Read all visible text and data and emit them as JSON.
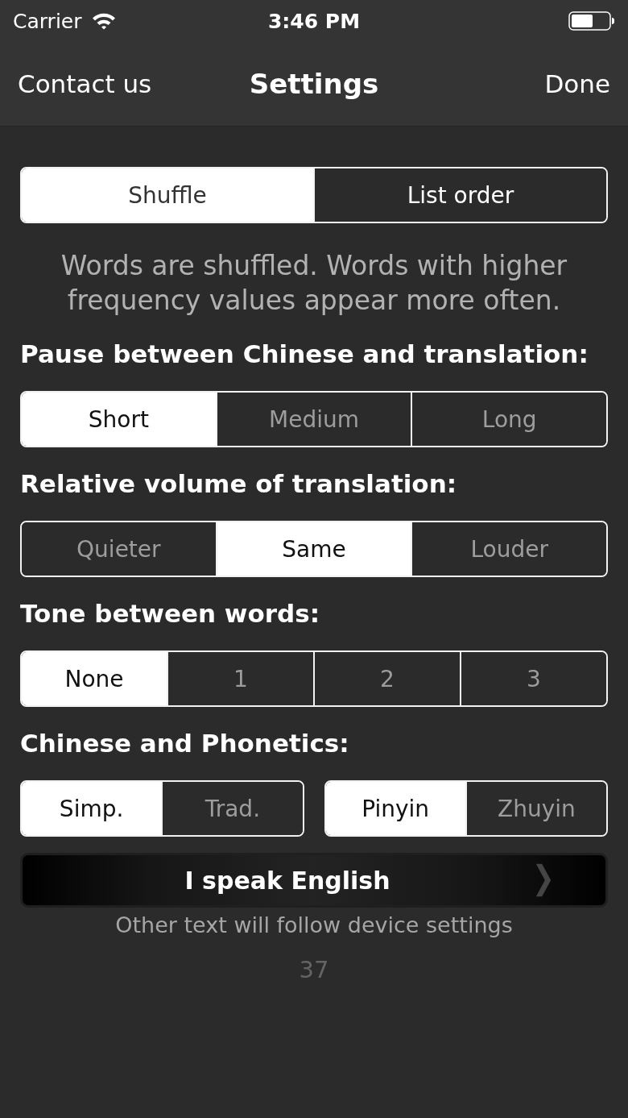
{
  "status_bar": {
    "carrier": "Carrier",
    "time": "3:46 PM"
  },
  "nav_bar": {
    "left_button": "Contact us",
    "title": "Settings",
    "right_button": "Done"
  },
  "order": {
    "kind": "bright",
    "segments": [
      {
        "label": "Shuffle",
        "selected": true
      },
      {
        "label": "List order",
        "selected": false
      }
    ]
  },
  "order_description": "Words are shuffled. Words with higher frequency values appear more often.",
  "settings": [
    {
      "heading": "Pause between Chinese and translation:",
      "controls": [
        {
          "kind": "dim",
          "segments": [
            {
              "label": "Short",
              "selected": true
            },
            {
              "label": "Medium",
              "selected": false
            },
            {
              "label": "Long",
              "selected": false
            }
          ]
        }
      ]
    },
    {
      "heading": "Relative volume of translation:",
      "controls": [
        {
          "kind": "dim",
          "segments": [
            {
              "label": "Quieter",
              "selected": false
            },
            {
              "label": "Same",
              "selected": true
            },
            {
              "label": "Louder",
              "selected": false
            }
          ]
        }
      ]
    },
    {
      "heading": "Tone between words:",
      "controls": [
        {
          "kind": "dim",
          "segments": [
            {
              "label": "None",
              "selected": true
            },
            {
              "label": "1",
              "selected": false
            },
            {
              "label": "2",
              "selected": false
            },
            {
              "label": "3",
              "selected": false
            }
          ]
        }
      ]
    },
    {
      "heading": "Chinese and Phonetics:",
      "controls": [
        {
          "kind": "dim",
          "segments": [
            {
              "label": "Simp.",
              "selected": true
            },
            {
              "label": "Trad.",
              "selected": false
            }
          ]
        },
        {
          "kind": "dim",
          "segments": [
            {
              "label": "Pinyin",
              "selected": true
            },
            {
              "label": "Zhuyin",
              "selected": false
            }
          ]
        }
      ]
    }
  ],
  "language_button": {
    "label": "I speak English"
  },
  "language_note": "Other text will follow device settings",
  "footer_number": "37"
}
